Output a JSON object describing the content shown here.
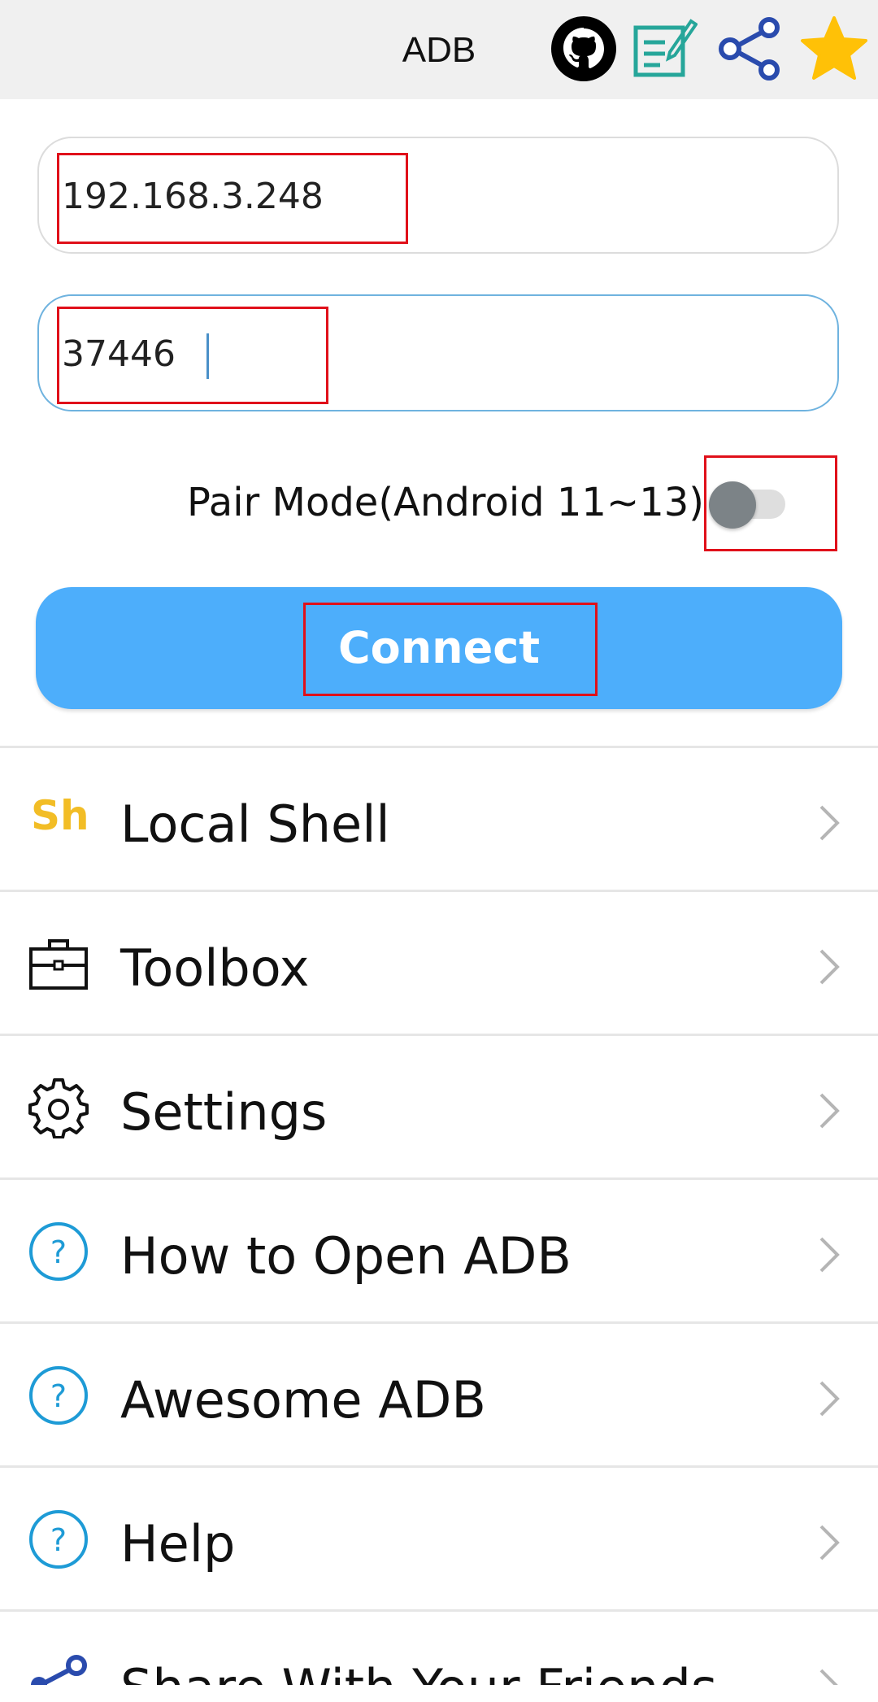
{
  "appbar": {
    "title": "ADB",
    "icons": [
      "github-icon",
      "note-edit-icon",
      "share-icon",
      "star-icon"
    ],
    "colors": {
      "background": "#f0f0f0",
      "note": "#26a69a",
      "share": "#2a4bad",
      "star": "#ffc107"
    }
  },
  "connection": {
    "ip_value": "192.168.3.248",
    "port_value": "37446",
    "pair_mode_label": "Pair Mode(Android 11~13)",
    "pair_mode_enabled": false,
    "connect_label": "Connect",
    "connect_color": "#4daefb"
  },
  "menu": {
    "items": [
      {
        "label": "Local Shell",
        "icon": "sh-text-icon",
        "icon_text": "Sh"
      },
      {
        "label": "Toolbox",
        "icon": "toolbox-icon"
      },
      {
        "label": "Settings",
        "icon": "gear-icon"
      },
      {
        "label": "How to Open ADB",
        "icon": "help-circle-icon"
      },
      {
        "label": "Awesome ADB",
        "icon": "help-circle-icon"
      },
      {
        "label": "Help",
        "icon": "help-circle-icon"
      },
      {
        "label": "Share With Your Friends",
        "icon": "share-icon"
      }
    ]
  },
  "highlight_color": "#e0101a"
}
